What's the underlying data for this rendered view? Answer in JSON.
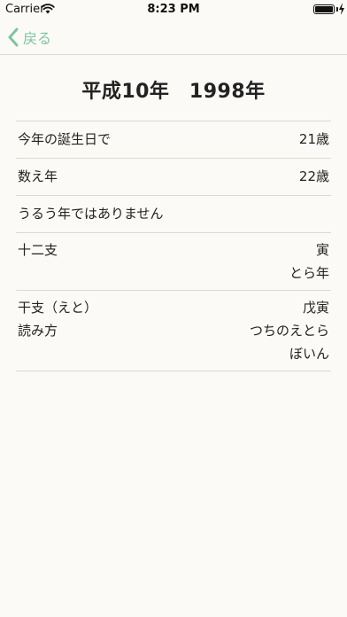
{
  "status": {
    "carrier": "Carrier",
    "time": "8:23 PM",
    "battery_level": 1.0
  },
  "nav": {
    "back_label": "戻る",
    "accent_color": "#7ec4a1"
  },
  "title": "平成10年　1998年",
  "rows": {
    "birthday": {
      "label": "今年の誕生日で",
      "value": "21歳"
    },
    "kazoedoshi": {
      "label": "数え年",
      "value": "22歳"
    },
    "leap": {
      "label": "うるう年ではありません"
    },
    "junishi": {
      "label": "十二支",
      "value": "寅",
      "reading": "とら年"
    },
    "eto": {
      "label": "干支（えと）",
      "reading_label": "読み方",
      "value": "戊寅",
      "reading_1": "つちのえとら",
      "reading_2": "ぼいん"
    }
  }
}
